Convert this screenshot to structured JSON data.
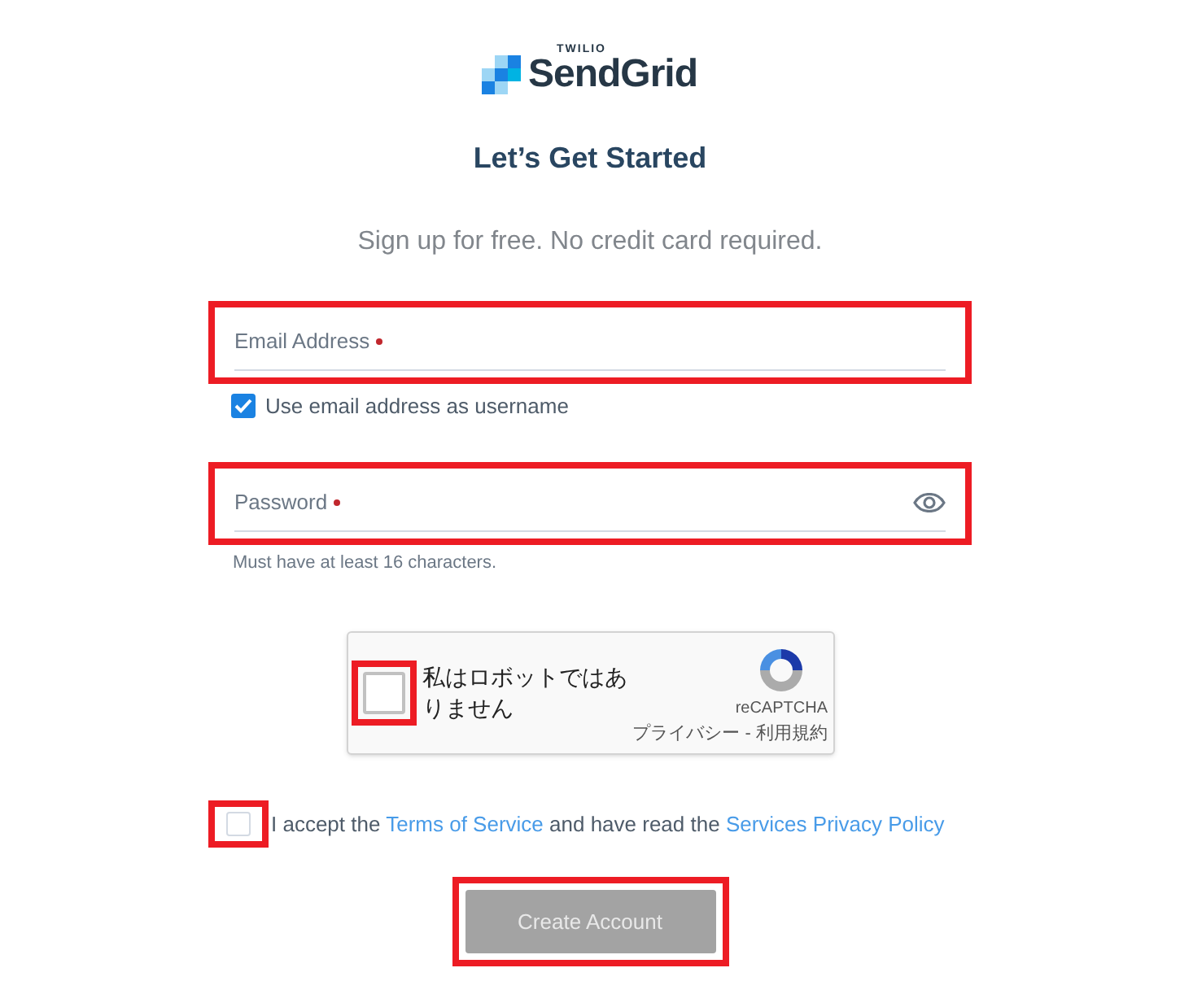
{
  "logo": {
    "overline": "TWILIO",
    "name": "SendGrid"
  },
  "title": "Let’s Get Started",
  "subtitle": "Sign up for free. No credit card required.",
  "fields": [
    {
      "kind": "text",
      "label": "Email Address",
      "required": true,
      "highlighted": true
    },
    {
      "kind": "password",
      "label": "Password",
      "required": true,
      "highlighted": true,
      "hint": "Must have at least 16 characters."
    }
  ],
  "username_checkbox": {
    "label": "Use email address as username",
    "checked": true
  },
  "captcha": {
    "label": "私はロボットではありません",
    "checked": false,
    "highlighted": true,
    "brand": "reCAPTCHA",
    "footer": "プライバシー - 利用規約"
  },
  "terms": {
    "checked": false,
    "highlighted": true,
    "parts": [
      {
        "kind": "text",
        "text": "I accept the "
      },
      {
        "kind": "link",
        "text": "Terms of Service"
      },
      {
        "kind": "text",
        "text": " and have read the "
      },
      {
        "kind": "link",
        "text": "Services Privacy Policy"
      }
    ]
  },
  "submit": {
    "label": "Create Account",
    "disabled": true,
    "highlighted": true
  }
}
